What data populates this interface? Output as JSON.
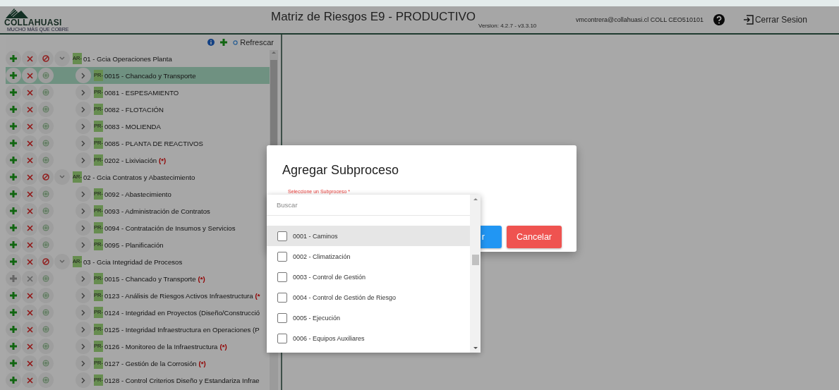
{
  "header": {
    "logo": {
      "name": "COLLAHUASI",
      "tagline": "MUCHO MÁS QUE COBRE"
    },
    "title": "Matriz de Riesgos E9 - PRODUCTIVO",
    "version": "Version: 4.2.7 - v3.3.10",
    "user": "vmcontrera@collahuasi.cl COLL CEO510101",
    "logout": "Cerrar Sesion"
  },
  "tree": {
    "refresh": "Refrescar",
    "areas": [
      {
        "badge": "AR-",
        "label": "01 - Gcia Operaciones Planta",
        "expanded": true,
        "children": [
          {
            "badge": "PR-",
            "label": "0015 - Chancado y Transporte",
            "selected": true,
            "disabled": false,
            "expanded": false
          },
          {
            "badge": "PR-",
            "label": "0081 - ESPESAMIENTO",
            "selected": false,
            "disabled": false,
            "expanded": false
          },
          {
            "badge": "PR-",
            "label": "0082 - FLOTACIÓN",
            "selected": false,
            "disabled": false,
            "expanded": false
          },
          {
            "badge": "PR-",
            "label": "0083 - MOLIENDA",
            "selected": false,
            "disabled": false,
            "expanded": false
          },
          {
            "badge": "PR-",
            "label": "0085 - PLANTA DE REACTIVOS",
            "selected": false,
            "disabled": false,
            "expanded": false
          },
          {
            "badge": "PR-",
            "label": "0202 - Lixiviación",
            "flag": "(*)",
            "selected": false,
            "disabled": false,
            "expanded": false
          }
        ]
      },
      {
        "badge": "AR-",
        "label": "02 - Gcia Contratos y Abastecimiento",
        "expanded": true,
        "children": [
          {
            "badge": "PR-",
            "label": "0092 - Abastecimiento",
            "selected": false,
            "disabled": false,
            "expanded": false
          },
          {
            "badge": "PR-",
            "label": "0093 - Administración de Contratos",
            "selected": false,
            "disabled": false,
            "expanded": false
          },
          {
            "badge": "PR-",
            "label": "0094 - Contratación de Insumos y Servicios",
            "selected": false,
            "disabled": false,
            "expanded": false
          },
          {
            "badge": "PR-",
            "label": "0095 - Planificación",
            "selected": false,
            "disabled": false,
            "expanded": false
          }
        ]
      },
      {
        "badge": "AR-",
        "label": "03 - Gcia Integridad de Procesos",
        "expanded": true,
        "children": [
          {
            "badge": "PR-",
            "label": "0015 - Chancado y Transporte",
            "flag": "(*)",
            "selected": false,
            "disabled": true,
            "expanded": false
          },
          {
            "badge": "PR-",
            "label": "0123 - Análisis de Riesgos Activos Infraestructura",
            "flag": "(*",
            "selected": false,
            "disabled": false,
            "expanded": false
          },
          {
            "badge": "PR-",
            "label": "0124 - Integridad en Proyectos (Diseño/Construcció",
            "selected": false,
            "disabled": false,
            "expanded": false
          },
          {
            "badge": "PR-",
            "label": "0125 - Integridad Infraestructura en Operaciones (P",
            "selected": false,
            "disabled": false,
            "expanded": false
          },
          {
            "badge": "PR-",
            "label": "0126 - Monitoreo de la Infraestructura",
            "flag": "(*)",
            "selected": false,
            "disabled": false,
            "expanded": false
          },
          {
            "badge": "PR-",
            "label": "0127 - Gestión de la Corrosión",
            "flag": "(*)",
            "selected": false,
            "disabled": false,
            "expanded": false
          },
          {
            "badge": "PR-",
            "label": "0128 - Control Criterios Diseño y Estandariza Infrae",
            "selected": false,
            "disabled": false,
            "expanded": false
          }
        ]
      }
    ]
  },
  "dialog": {
    "title": "Agregar Subproceso",
    "field_label": "Seleccione un Subproceso *",
    "dropdown": {
      "placeholder": "Buscar",
      "options": [
        {
          "label": "0001 - Caminos",
          "checked": false,
          "highlighted": true
        },
        {
          "label": "0002 - Climatización",
          "checked": false,
          "highlighted": false
        },
        {
          "label": "0003 - Control de Gestión",
          "checked": false,
          "highlighted": false
        },
        {
          "label": "0004 - Control de Gestión de Riesgo",
          "checked": false,
          "highlighted": false
        },
        {
          "label": "0005 - Ejecución",
          "checked": false,
          "highlighted": false
        },
        {
          "label": "0006 - Equipos Auxiliares",
          "checked": false,
          "highlighted": false
        }
      ]
    },
    "buttons": [
      {
        "label": "r",
        "kind": "primary"
      },
      {
        "label": "Cancelar",
        "kind": "danger"
      }
    ]
  }
}
